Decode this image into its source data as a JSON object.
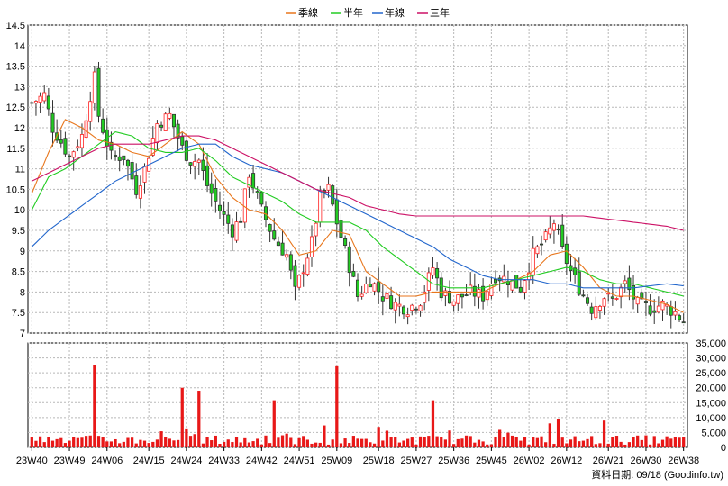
{
  "chart_data": {
    "type": "candlestick+line+bar",
    "legend": [
      {
        "name": "季線",
        "color": "#e8761c"
      },
      {
        "name": "半年",
        "color": "#22cc22"
      },
      {
        "name": "年線",
        "color": "#2266cc"
      },
      {
        "name": "三年",
        "color": "#cc1166"
      }
    ],
    "price_axis": {
      "min": 7,
      "max": 14.5,
      "ticks": [
        "14.5",
        "14",
        "13.5",
        "13",
        "12.5",
        "12",
        "11.5",
        "11",
        "10.5",
        "10",
        "9.5",
        "9",
        "8.5",
        "8",
        "7.5",
        "7"
      ]
    },
    "volume_axis": {
      "min": 0,
      "max": 35000,
      "ticks": [
        "35,000",
        "30,000",
        "25,000",
        "20,000",
        "15,000",
        "10,000",
        "5,000",
        "0"
      ]
    },
    "x_labels": [
      "23W40",
      "23W49",
      "24W06",
      "24W15",
      "24W24",
      "24W33",
      "24W42",
      "24W51",
      "25W09",
      "25W18",
      "25W27",
      "25W36",
      "25W45",
      "26W02",
      "26W12",
      "26W21",
      "26W30",
      "26W38"
    ],
    "weeks": 157,
    "close_anchors": [
      [
        0,
        12.6
      ],
      [
        3,
        12.8
      ],
      [
        5,
        12.0
      ],
      [
        9,
        11.3
      ],
      [
        12,
        11.8
      ],
      [
        14,
        12.8
      ],
      [
        15,
        13.2
      ],
      [
        16,
        12.3
      ],
      [
        19,
        11.3
      ],
      [
        22,
        11.3
      ],
      [
        25,
        10.5
      ],
      [
        27,
        11.0
      ],
      [
        30,
        12.1
      ],
      [
        33,
        12.3
      ],
      [
        36,
        11.5
      ],
      [
        38,
        11.2
      ],
      [
        40,
        11.2
      ],
      [
        42,
        10.6
      ],
      [
        45,
        10.0
      ],
      [
        48,
        9.5
      ],
      [
        50,
        9.8
      ],
      [
        52,
        10.9
      ],
      [
        55,
        10.0
      ],
      [
        58,
        9.3
      ],
      [
        61,
        8.9
      ],
      [
        63,
        8.0
      ],
      [
        65,
        8.6
      ],
      [
        67,
        9.2
      ],
      [
        69,
        10.3
      ],
      [
        71,
        10.5
      ],
      [
        73,
        9.7
      ],
      [
        75,
        9.0
      ],
      [
        78,
        7.9
      ],
      [
        81,
        8.3
      ],
      [
        84,
        7.9
      ],
      [
        87,
        7.7
      ],
      [
        90,
        7.6
      ],
      [
        93,
        7.8
      ],
      [
        96,
        8.6
      ],
      [
        98,
        8.0
      ],
      [
        101,
        7.8
      ],
      [
        105,
        8.0
      ],
      [
        108,
        7.9
      ],
      [
        111,
        8.4
      ],
      [
        114,
        8.3
      ],
      [
        117,
        8.1
      ],
      [
        120,
        8.9
      ],
      [
        123,
        9.3
      ],
      [
        125,
        9.7
      ],
      [
        127,
        9.0
      ],
      [
        129,
        8.5
      ],
      [
        131,
        8.1
      ],
      [
        134,
        7.6
      ],
      [
        137,
        7.9
      ],
      [
        139,
        7.8
      ],
      [
        142,
        8.2
      ],
      [
        145,
        7.7
      ],
      [
        148,
        7.6
      ],
      [
        151,
        7.7
      ],
      [
        154,
        7.5
      ],
      [
        156,
        7.3
      ]
    ],
    "volume_samples": [
      [
        15,
        27500
      ],
      [
        36,
        20000
      ],
      [
        40,
        19000
      ],
      [
        58,
        15800
      ],
      [
        73,
        27200
      ],
      [
        96,
        15800
      ],
      [
        126,
        9500
      ],
      [
        137,
        9000
      ]
    ],
    "ma_quarter": [
      [
        0,
        10.4
      ],
      [
        4,
        11.4
      ],
      [
        8,
        12.2
      ],
      [
        12,
        12.0
      ],
      [
        16,
        11.7
      ],
      [
        20,
        11.6
      ],
      [
        24,
        11.4
      ],
      [
        28,
        11.3
      ],
      [
        32,
        11.6
      ],
      [
        36,
        11.9
      ],
      [
        40,
        11.6
      ],
      [
        44,
        10.8
      ],
      [
        48,
        10.3
      ],
      [
        52,
        10.0
      ],
      [
        56,
        9.9
      ],
      [
        60,
        9.5
      ],
      [
        64,
        8.9
      ],
      [
        68,
        9.0
      ],
      [
        72,
        9.5
      ],
      [
        76,
        9.4
      ],
      [
        80,
        8.5
      ],
      [
        84,
        8.2
      ],
      [
        88,
        7.9
      ],
      [
        92,
        7.9
      ],
      [
        96,
        8.0
      ],
      [
        100,
        8.0
      ],
      [
        104,
        8.0
      ],
      [
        108,
        8.0
      ],
      [
        112,
        8.2
      ],
      [
        116,
        8.3
      ],
      [
        120,
        8.5
      ],
      [
        124,
        8.9
      ],
      [
        128,
        9.0
      ],
      [
        132,
        8.6
      ],
      [
        136,
        8.1
      ],
      [
        140,
        7.9
      ],
      [
        144,
        7.9
      ],
      [
        148,
        7.8
      ],
      [
        152,
        7.7
      ],
      [
        156,
        7.5
      ]
    ],
    "ma_half": [
      [
        0,
        10.0
      ],
      [
        4,
        10.8
      ],
      [
        8,
        11.0
      ],
      [
        12,
        11.3
      ],
      [
        16,
        11.6
      ],
      [
        20,
        11.9
      ],
      [
        24,
        11.8
      ],
      [
        28,
        11.5
      ],
      [
        32,
        11.4
      ],
      [
        36,
        11.4
      ],
      [
        40,
        11.5
      ],
      [
        44,
        11.2
      ],
      [
        48,
        10.8
      ],
      [
        52,
        10.6
      ],
      [
        56,
        10.4
      ],
      [
        60,
        10.2
      ],
      [
        64,
        9.9
      ],
      [
        68,
        9.7
      ],
      [
        72,
        9.7
      ],
      [
        76,
        9.7
      ],
      [
        80,
        9.5
      ],
      [
        84,
        9.1
      ],
      [
        88,
        8.8
      ],
      [
        92,
        8.5
      ],
      [
        96,
        8.2
      ],
      [
        100,
        8.1
      ],
      [
        104,
        8.1
      ],
      [
        108,
        8.1
      ],
      [
        112,
        8.2
      ],
      [
        116,
        8.3
      ],
      [
        120,
        8.4
      ],
      [
        124,
        8.5
      ],
      [
        128,
        8.6
      ],
      [
        132,
        8.5
      ],
      [
        136,
        8.3
      ],
      [
        140,
        8.2
      ],
      [
        144,
        8.2
      ],
      [
        148,
        8.1
      ],
      [
        152,
        8.0
      ],
      [
        156,
        7.9
      ]
    ],
    "ma_year": [
      [
        0,
        9.1
      ],
      [
        4,
        9.5
      ],
      [
        8,
        9.8
      ],
      [
        12,
        10.1
      ],
      [
        16,
        10.4
      ],
      [
        20,
        10.7
      ],
      [
        24,
        10.9
      ],
      [
        28,
        11.1
      ],
      [
        32,
        11.3
      ],
      [
        36,
        11.5
      ],
      [
        40,
        11.6
      ],
      [
        44,
        11.6
      ],
      [
        48,
        11.3
      ],
      [
        52,
        11.1
      ],
      [
        56,
        11.0
      ],
      [
        60,
        10.9
      ],
      [
        64,
        10.7
      ],
      [
        68,
        10.5
      ],
      [
        72,
        10.3
      ],
      [
        76,
        10.1
      ],
      [
        80,
        9.9
      ],
      [
        84,
        9.7
      ],
      [
        88,
        9.5
      ],
      [
        92,
        9.3
      ],
      [
        96,
        9.1
      ],
      [
        100,
        8.8
      ],
      [
        104,
        8.6
      ],
      [
        108,
        8.4
      ],
      [
        112,
        8.3
      ],
      [
        116,
        8.3
      ],
      [
        120,
        8.3
      ],
      [
        124,
        8.2
      ],
      [
        128,
        8.2
      ],
      [
        132,
        8.1
      ],
      [
        136,
        8.1
      ],
      [
        140,
        8.1
      ],
      [
        144,
        8.1
      ],
      [
        148,
        8.15
      ],
      [
        152,
        8.2
      ],
      [
        156,
        8.15
      ]
    ],
    "ma_3year": [
      [
        0,
        10.7
      ],
      [
        4,
        10.9
      ],
      [
        8,
        11.1
      ],
      [
        12,
        11.3
      ],
      [
        16,
        11.5
      ],
      [
        20,
        11.6
      ],
      [
        24,
        11.6
      ],
      [
        28,
        11.6
      ],
      [
        32,
        11.7
      ],
      [
        36,
        11.8
      ],
      [
        40,
        11.8
      ],
      [
        44,
        11.7
      ],
      [
        48,
        11.5
      ],
      [
        52,
        11.3
      ],
      [
        56,
        11.1
      ],
      [
        60,
        10.9
      ],
      [
        64,
        10.7
      ],
      [
        68,
        10.5
      ],
      [
        72,
        10.4
      ],
      [
        76,
        10.3
      ],
      [
        80,
        10.1
      ],
      [
        84,
        10.0
      ],
      [
        88,
        9.9
      ],
      [
        92,
        9.85
      ],
      [
        96,
        9.85
      ],
      [
        100,
        9.85
      ],
      [
        104,
        9.85
      ],
      [
        108,
        9.85
      ],
      [
        112,
        9.85
      ],
      [
        116,
        9.85
      ],
      [
        120,
        9.85
      ],
      [
        124,
        9.85
      ],
      [
        128,
        9.85
      ],
      [
        132,
        9.85
      ],
      [
        136,
        9.8
      ],
      [
        140,
        9.75
      ],
      [
        144,
        9.7
      ],
      [
        148,
        9.65
      ],
      [
        152,
        9.6
      ],
      [
        156,
        9.5
      ]
    ],
    "footer": "資料日期: 09/18  (Goodinfo.tw)"
  }
}
